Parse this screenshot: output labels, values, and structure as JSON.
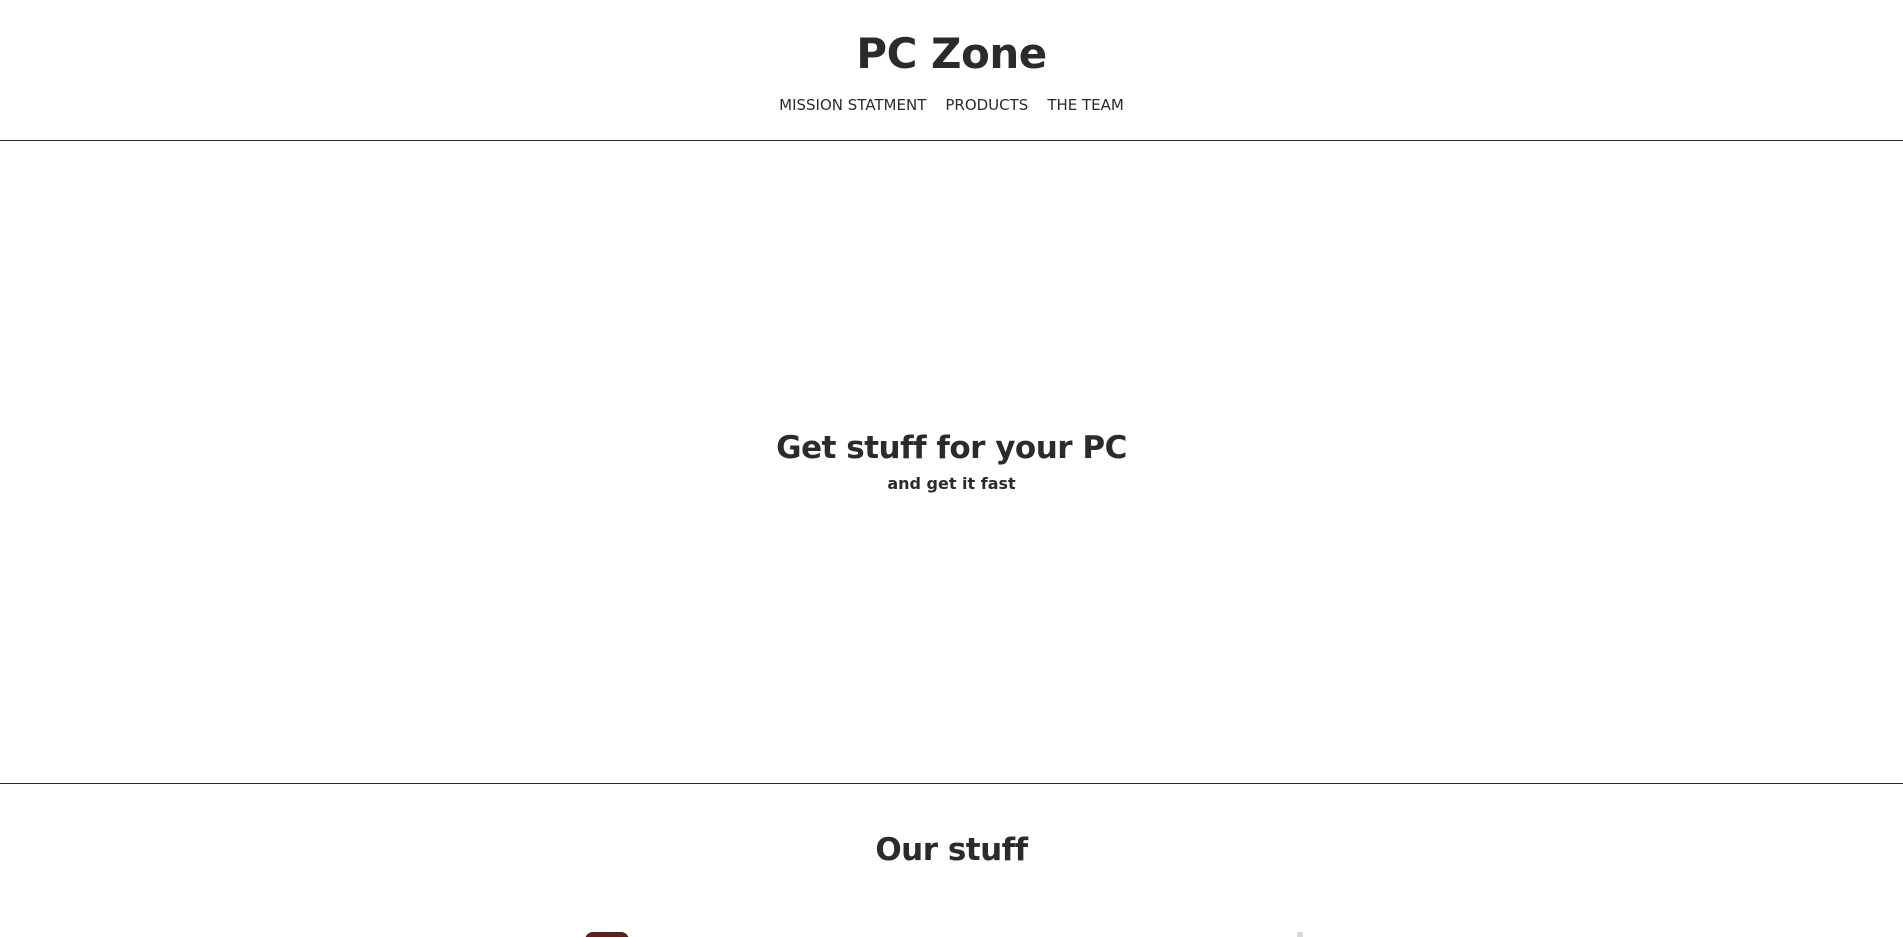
{
  "header": {
    "title": "PC Zone",
    "nav": [
      {
        "label": "MISSION STATMENT"
      },
      {
        "label": "PRODUCTS"
      },
      {
        "label": "THE TEAM"
      }
    ]
  },
  "hero": {
    "heading": "Get stuff for your PC",
    "subheading": "and get it fast"
  },
  "products": {
    "heading": "Our stuff"
  },
  "colors": {
    "text": "#2b2b2b",
    "background": "#ffffff",
    "divider": "#2b2b2b"
  }
}
